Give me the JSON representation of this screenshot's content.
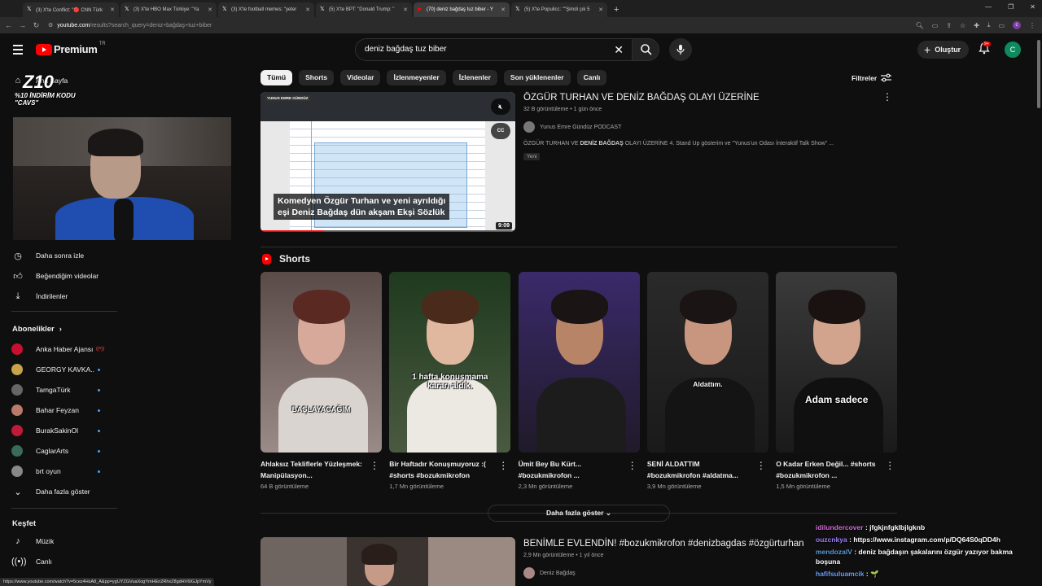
{
  "browser": {
    "tabs": [
      {
        "label": "(3) X'te Conflict: \"🔴 CNN Türk",
        "icon": "x-icon",
        "active": false
      },
      {
        "label": "(3) X'te HBO Max Türkiye: \"Ya",
        "icon": "x-icon",
        "active": false
      },
      {
        "label": "(3) X'te football memes: \"yeter",
        "icon": "x-icon",
        "active": false
      },
      {
        "label": "(5) X'te BPT: \"Donald Trump: \"",
        "icon": "x-icon",
        "active": false
      },
      {
        "label": "(70) deniz bağdaş tuz biber - Y",
        "icon": "youtube-icon",
        "active": true
      },
      {
        "label": "(5) X'te Populicc: \"\"Şimdi çık 5",
        "icon": "x-icon",
        "active": false
      }
    ],
    "url_host": "youtube.com",
    "url_path": "/results?search_query=deniz+bağdaş+tuz+biber",
    "status_url": "https://www.youtube.com/watch?v=5cez4HsA8_A&pp=ygUYZGVuaXogYmHEn2RhxZ8gdHV6IGJpYmVy"
  },
  "header": {
    "logo_text": "Premium",
    "logo_country": "TR",
    "search_value": "deniz bağdaş tuz biber",
    "create_label": "Oluştur",
    "notif_count": "9+",
    "account_initial": "C"
  },
  "sidebar": {
    "home_label": "Ana Sayfa",
    "items": [
      {
        "label": "Daha sonra izle",
        "icon": "clock-icon"
      },
      {
        "label": "Beğendiğim videolar",
        "icon": "thumbs-up-icon"
      },
      {
        "label": "İndirilenler",
        "icon": "download-icon"
      }
    ],
    "subs_title": "Abonelikler",
    "subs_chevron": "›",
    "channels": [
      {
        "name": "Anka Haber Ajansı",
        "color": "#c8102e",
        "live": true
      },
      {
        "name": "GEORGY KAVKA...",
        "color": "#c9a34a",
        "live": false
      },
      {
        "name": "TamgaTürk",
        "color": "#666666",
        "live": false
      },
      {
        "name": "Bahar Feyzan",
        "color": "#b87a6a",
        "live": false
      },
      {
        "name": "BurakSakinOl",
        "color": "#c01a3a",
        "live": false
      },
      {
        "name": "CaglarArts",
        "color": "#3a6b5a",
        "live": false
      },
      {
        "name": "brt oyun",
        "color": "#888888",
        "live": false
      }
    ],
    "more_label": "Daha fazla göster",
    "explore_title": "Keşfet",
    "explore_items": [
      {
        "label": "Müzik",
        "icon": "music-icon"
      },
      {
        "label": "Canlı",
        "icon": "live-icon"
      }
    ]
  },
  "stream_overlay": {
    "logo": "Z10",
    "promo": "%10 İNDİRİM KODU\n\"CAVS\""
  },
  "chips": [
    "Tümü",
    "Shorts",
    "Videolar",
    "İzlenmeyenler",
    "İzlenenler",
    "Son yüklenenler",
    "Canlı"
  ],
  "filters_label": "Filtreler",
  "main_video": {
    "title": "ÖZGÜR TURHAN VE DENİZ BAĞDAŞ OLAYI ÜZERİNE",
    "views": "32 B görüntüleme",
    "age": "1 gün önce",
    "channel": "Yunus Emre Gündüz PODCAST",
    "desc_pre": "ÖZGÜR TURHAN VE ",
    "desc_bold": "DENİZ BAĞDAŞ",
    "desc_post": " OLAYI ÜZERİNE 4. Stand Up gösterim ve \"Yunus'un Odası İnteraktif Talk Show\" ...",
    "badge": "Yeni",
    "thumb_badge": "YUNUS EMRE GÜNDÜZ",
    "caption_line1": "Komedyen Özgür Turhan ve yeni ayrıldığı",
    "caption_line2": "eşi Deniz Bağdaş dün akşam Ekşi Sözlük",
    "duration": "9:09",
    "cc": "CC",
    "progress": 0.25
  },
  "shorts_title": "Shorts",
  "shorts": [
    {
      "title": "Ahlaksız Tekliflerle Yüzleşmek: Manipülasyon...",
      "views": "64 B görüntüleme",
      "overlay": "BAŞLAYACAĞIM"
    },
    {
      "title": "Bir Haftadır Konuşmuyoruz :( #shorts #bozukmikrofon",
      "views": "1,7 Mn görüntüleme",
      "overlay": "1 hafta konuşmama kararı aldık."
    },
    {
      "title": "Ümit Bey Bu Kürt... #bozukmikrofon ...",
      "views": "2,3 Mn görüntüleme",
      "overlay": ""
    },
    {
      "title": "SENİ ALDATTIM #bozukmikrofon #aldatma...",
      "views": "3,9 Mn görüntüleme",
      "overlay": "Aldattım."
    },
    {
      "title": "O Kadar Erken Değil... #shorts #bozukmikrofon ...",
      "views": "1,5 Mn görüntüleme",
      "overlay": "Adam sadece"
    }
  ],
  "more_shorts_label": "Daha fazla göster",
  "video2": {
    "title": "BENİMLE EVLENDİN! #bozukmikrofon #denizbagdas #özgürturhan",
    "views": "2,9 Mn görüntüleme",
    "age": "1 yıl önce",
    "channel": "Deniz Bağdaş"
  },
  "chat": [
    {
      "user": "idilundercover",
      "color": "#d36ad6",
      "text": "jfgkjnfgklbjlgknb"
    },
    {
      "user": "ouzcnkya",
      "color": "#9b7bff",
      "text": "https://www.instagram.com/p/DQ64S0qDD4h"
    },
    {
      "user": "mendozalV",
      "color": "#5b9bd5",
      "text": "deniz bağdaşın şakalarını özgür yazıyor bakma boşuna"
    },
    {
      "user": "hafifsuluamcik",
      "color": "#6aa0ff",
      "text": "🌱"
    }
  ]
}
